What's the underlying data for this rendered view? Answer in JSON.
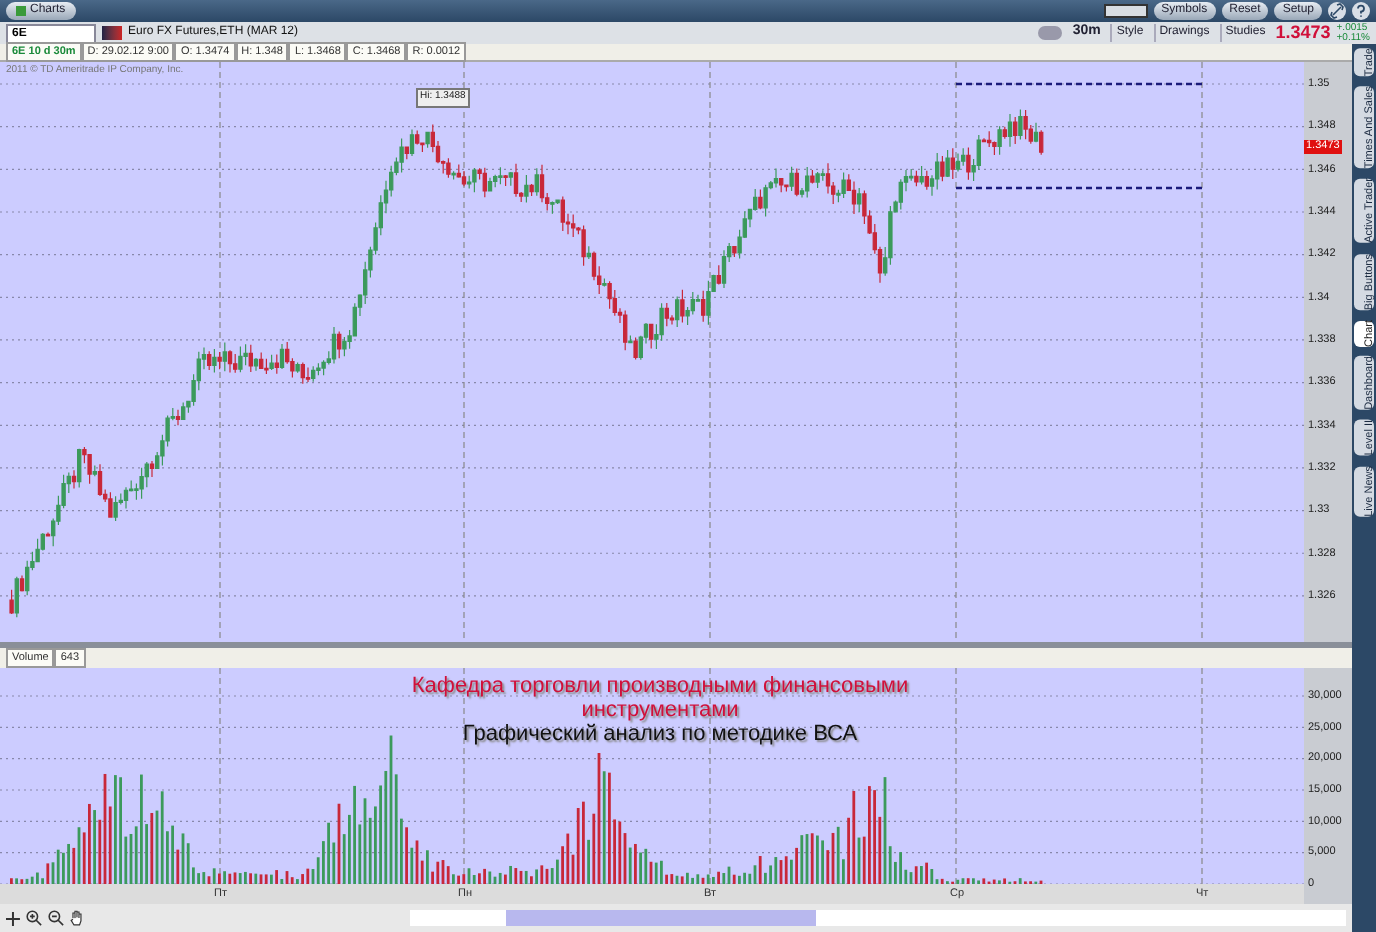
{
  "app_bar": {
    "tab": "Charts",
    "buttons": [
      "Symbols",
      "Reset",
      "Setup"
    ]
  },
  "toolbar": {
    "symbol": "6E",
    "instrument": "Euro FX Futures,ETH (MAR 12)",
    "aggregation": "30m",
    "buttons": [
      "Style",
      "Drawings",
      "Studies"
    ],
    "last_price": "1.3473",
    "change": "+.0015",
    "change_percent": "+0.11%"
  },
  "info_bar": [
    "6E 10 d 30m",
    "D: 29.02.12 9:00",
    "O: 1.3474",
    "H: 1.348",
    "L: 1.3468",
    "C: 1.3468",
    "R: 0.0012"
  ],
  "price_panel": {
    "copyright": "2011 © TD Ameritrade IP Company, Inc.",
    "high_label": "Hi: 1.3488",
    "current_price": "1.3473",
    "y_ticks": [
      "1.35",
      "1.348",
      "1.346",
      "1.344",
      "1.342",
      "1.34",
      "1.338",
      "1.336",
      "1.334",
      "1.332",
      "1.33",
      "1.328",
      "1.326"
    ]
  },
  "volume_panel": {
    "title": "Volume",
    "value": "643",
    "y_ticks": [
      "30,000",
      "25,000",
      "20,000",
      "15,000",
      "10,000",
      "5,000",
      "0"
    ],
    "overlay_lines": [
      {
        "text": "Кафедра торговли производными финансовыми",
        "color": "#d0103a"
      },
      {
        "text": "инструментами",
        "color": "#d0103a"
      },
      {
        "text": "Графический анализ по методике ВСА",
        "color": "#111111"
      }
    ]
  },
  "x_labels": [
    "Пт",
    "Пн",
    "Вт",
    "Ср",
    "Чт"
  ],
  "side_tabs": [
    {
      "label": "Trade",
      "selected": false
    },
    {
      "label": "Times And Sales",
      "selected": false
    },
    {
      "label": "Active Trader",
      "selected": false
    },
    {
      "label": "Big Buttons",
      "selected": false
    },
    {
      "label": "Chart",
      "selected": true
    },
    {
      "label": "Dashboard",
      "selected": false
    },
    {
      "label": "Level II",
      "selected": false
    },
    {
      "label": "Live News",
      "selected": false
    }
  ]
}
